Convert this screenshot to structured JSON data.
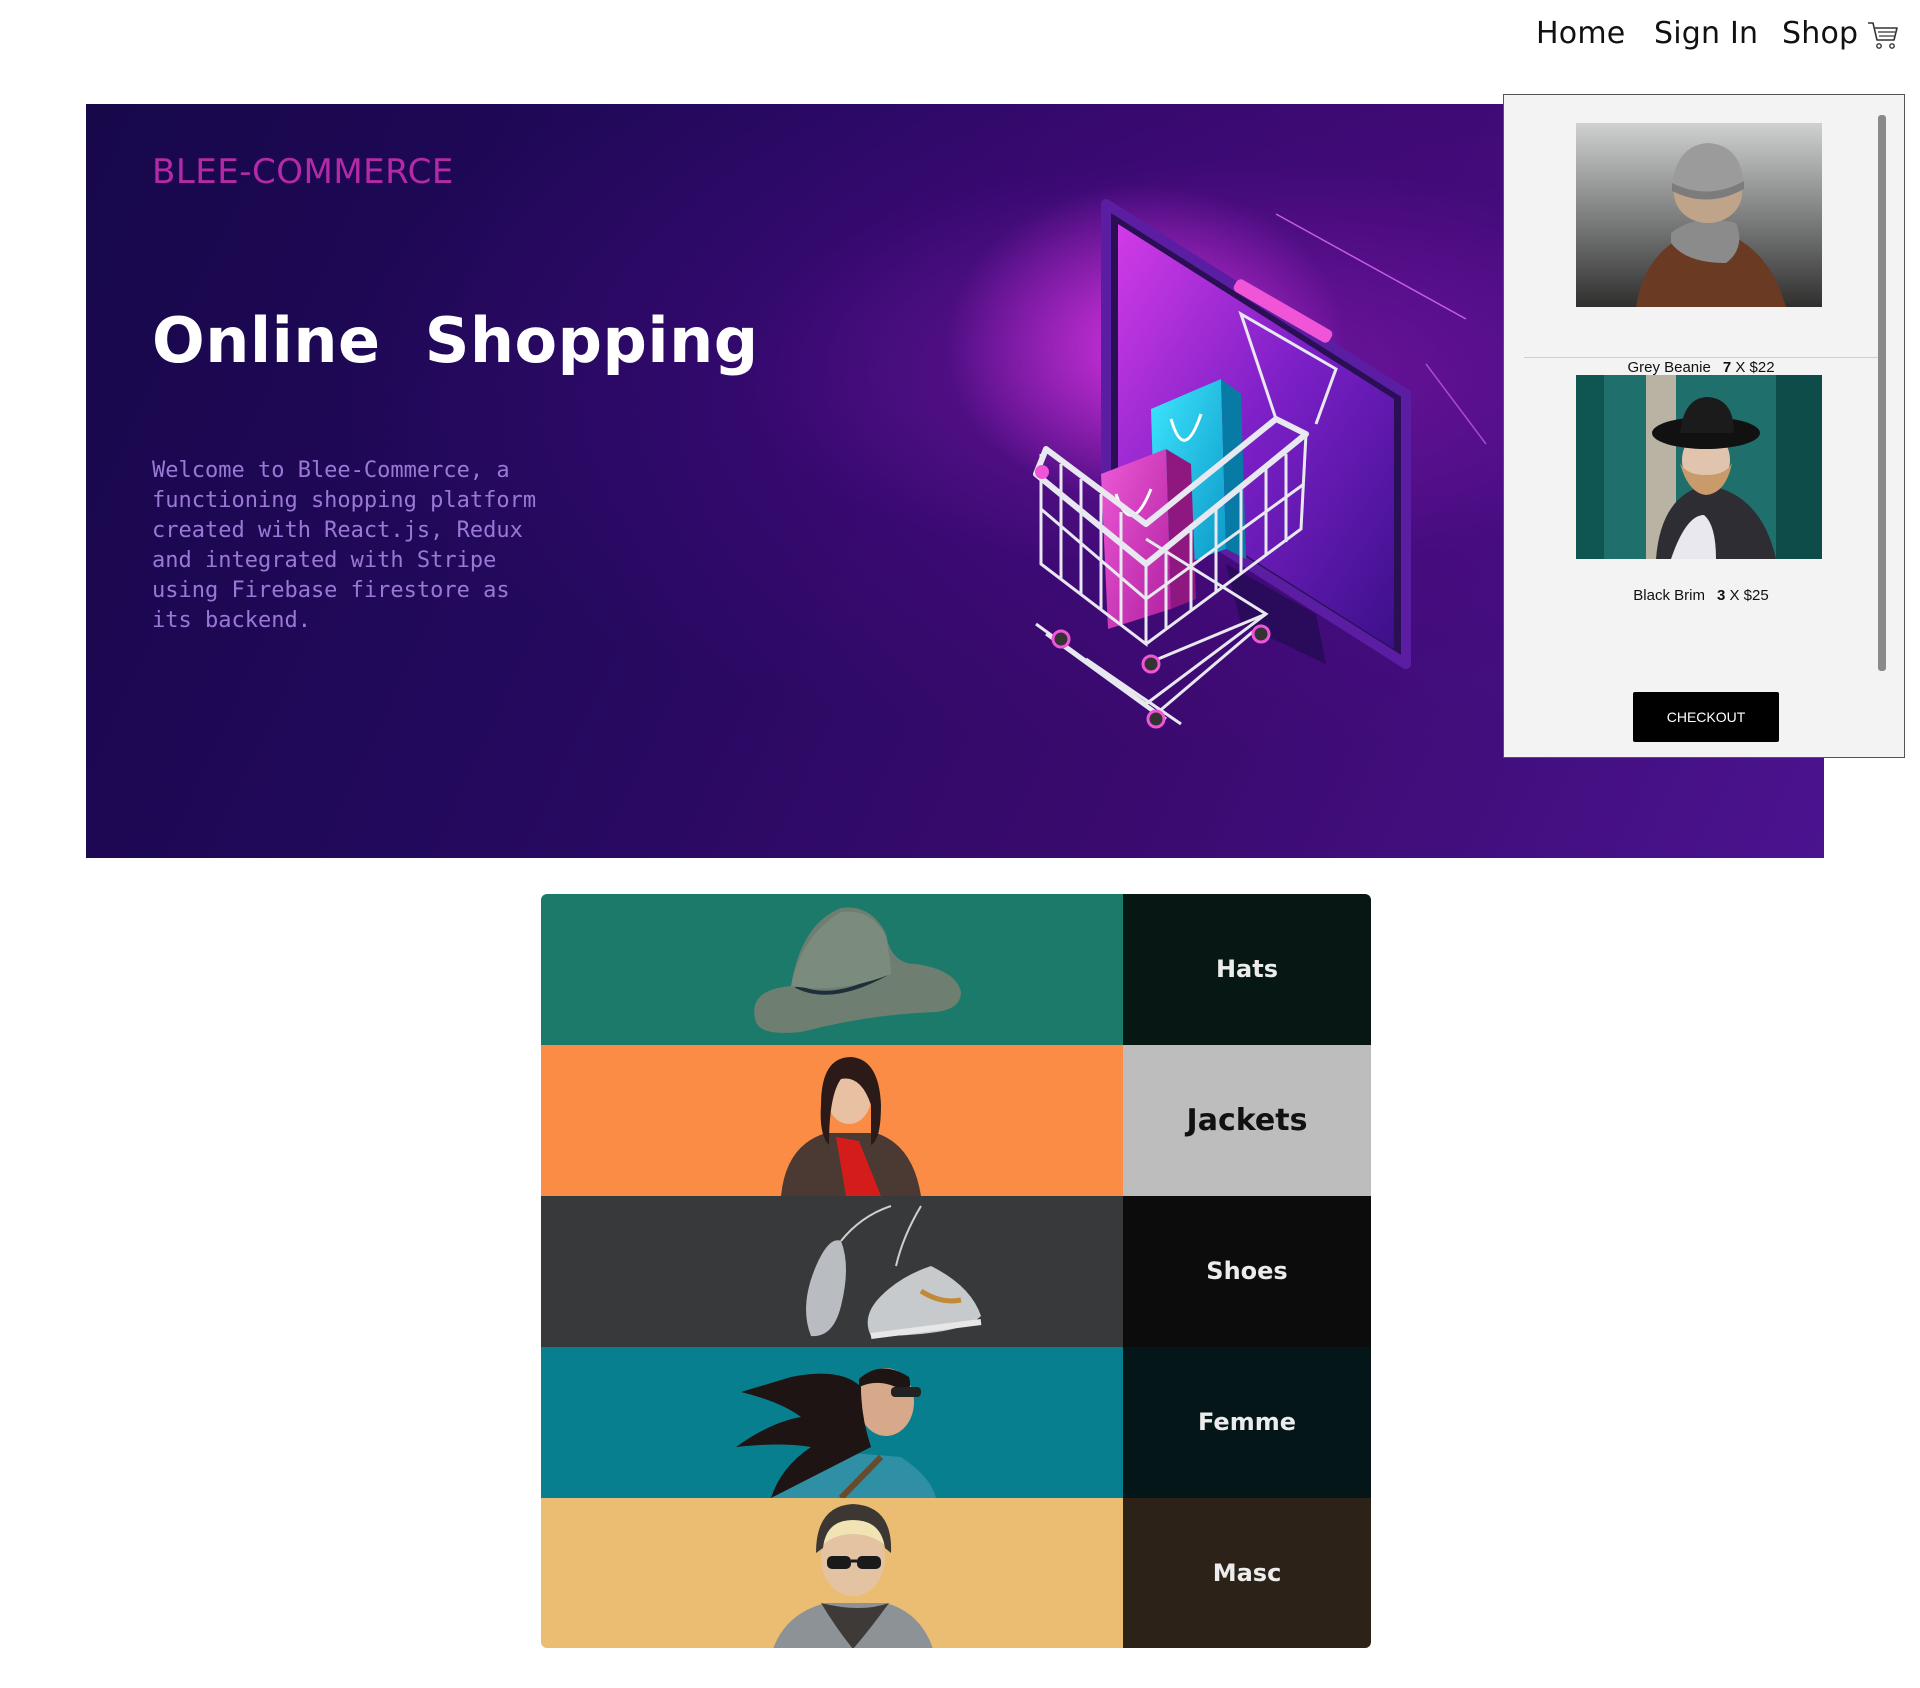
{
  "nav": {
    "home": "Home",
    "signin": "Sign In",
    "shop": "Shop",
    "cart_icon": "shopping-cart-icon"
  },
  "hero": {
    "brand": "BLEE-COMMERCE",
    "title": "Online  Shopping",
    "description": "Welcome to Blee-Commerce, a functioning shopping platform created with React.js, Redux and integrated with Stripe using Firebase firestore as its backend."
  },
  "cart": {
    "items": [
      {
        "name": "Grey Beanie",
        "quantity": "7",
        "separator": "X",
        "price": "$22"
      },
      {
        "name": "Black Brim",
        "quantity": "3",
        "separator": "X",
        "price": "$25"
      }
    ],
    "checkout_label": "CHECKOUT"
  },
  "categories": [
    {
      "label": "Hats",
      "bg": "#1c7a6b",
      "label_bg": "#071714",
      "label_color": "#ececec"
    },
    {
      "label": "Jackets",
      "bg": "#fb8c46",
      "label_bg": "#bdbdbd",
      "label_color": "#111111"
    },
    {
      "label": "Shoes",
      "bg": "#38393b",
      "label_bg": "#0c0c0c",
      "label_color": "#ececec"
    },
    {
      "label": "Femme",
      "bg": "#087f8f",
      "label_bg": "#041617",
      "label_color": "#ececec"
    },
    {
      "label": "Masc",
      "bg": "#ebbd73",
      "label_bg": "#2c2217",
      "label_color": "#ececec"
    }
  ],
  "colors": {
    "brand": "#b42aa6",
    "hero_dark": "#17084a",
    "hero_light": "#4b138f",
    "checkout_bg": "#000000"
  }
}
